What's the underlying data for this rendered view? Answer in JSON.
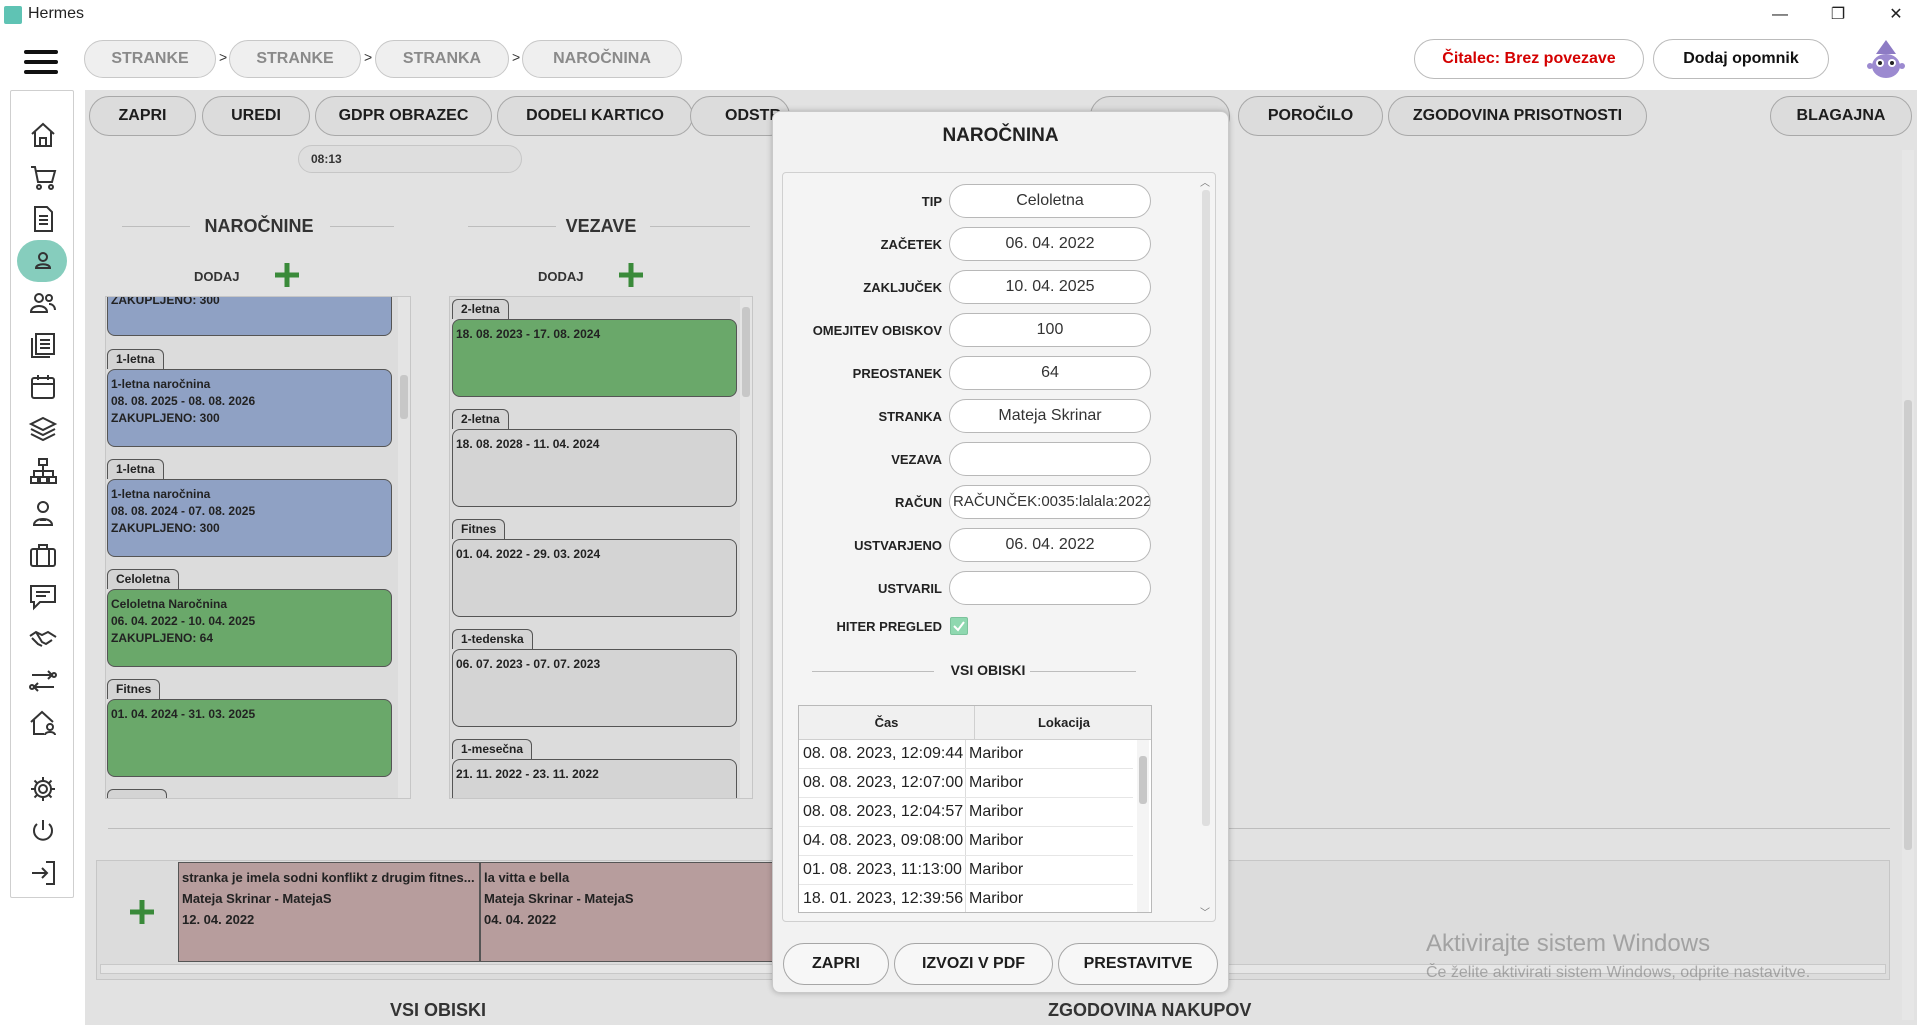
{
  "window": {
    "title": "Hermes",
    "minimize": "—",
    "restore": "❐",
    "close": "✕"
  },
  "breadcrumbs": [
    "STRANKE",
    "STRANKE",
    "STRANKA",
    "NAROČNINA"
  ],
  "breadcrumb_separator": ">",
  "header": {
    "reader_status": "Čitalec: Brez povezave",
    "add_reminder": "Dodaj opomnik"
  },
  "sidebar": {
    "items": [
      {
        "icon": "home-icon"
      },
      {
        "icon": "cart-icon"
      },
      {
        "icon": "document-icon"
      },
      {
        "icon": "user-icon",
        "active": true
      },
      {
        "icon": "users-icon"
      },
      {
        "icon": "list-icon"
      },
      {
        "icon": "calendar-icon"
      },
      {
        "icon": "layers-icon"
      },
      {
        "icon": "hierarchy-icon"
      },
      {
        "icon": "trainer-icon"
      },
      {
        "icon": "briefcase-icon"
      },
      {
        "icon": "message-icon"
      },
      {
        "icon": "handshake-icon"
      },
      {
        "icon": "transfer-icon"
      },
      {
        "icon": "house-icon"
      },
      {
        "icon": "settings-icon"
      },
      {
        "icon": "power-icon"
      },
      {
        "icon": "logout-icon"
      }
    ]
  },
  "toolbar": {
    "zapri": "ZAPRI",
    "uredi": "UREDI",
    "gdpr": "GDPR OBRAZEC",
    "dodeli": "DODELI KARTICO",
    "odstr": "ODSTR",
    "porocilo": "POROČILO",
    "zgodovina": "ZGODOVINA PRISOTNOSTI",
    "blagajna": "BLAGAJNA"
  },
  "time": "08:13",
  "narocnine": {
    "title": "NAROČNINE",
    "add_label": "DODAJ",
    "cards": [
      {
        "tag": "",
        "lines": [
          "ZAKUPLJENO: 300"
        ],
        "color": "blue"
      },
      {
        "tag": "1-letna",
        "lines": [
          "1-letna naročnina",
          "08. 08. 2025 - 08. 08. 2026",
          "ZAKUPLJENO: 300"
        ],
        "color": "blue"
      },
      {
        "tag": "1-letna",
        "lines": [
          "1-letna naročnina",
          "08. 08. 2024 - 07. 08. 2025",
          "ZAKUPLJENO: 300"
        ],
        "color": "blue"
      },
      {
        "tag": "Celoletna",
        "lines": [
          "Celoletna Naročnina",
          "06. 04. 2022 - 10. 04. 2025",
          "ZAKUPLJENO: 64"
        ],
        "color": "green"
      },
      {
        "tag": "Fitnes",
        "lines": [
          "01. 04. 2024 - 31. 03. 2025"
        ],
        "color": "green"
      }
    ]
  },
  "vezave": {
    "title": "VEZAVE",
    "add_label": "DODAJ",
    "cards": [
      {
        "tag": "2-letna",
        "lines": [
          "18. 08. 2023 - 17. 08. 2024"
        ],
        "color": "green"
      },
      {
        "tag": "2-letna",
        "lines": [
          "18. 08. 2028 - 11. 04. 2024"
        ],
        "color": "gray"
      },
      {
        "tag": "Fitnes",
        "lines": [
          "01. 04. 2022 - 29. 03. 2024"
        ],
        "color": "gray"
      },
      {
        "tag": "1-tedenska",
        "lines": [
          "06. 07. 2023 - 07. 07. 2023"
        ],
        "color": "gray"
      },
      {
        "tag": "1-mesečna",
        "lines": [
          "21. 11. 2022 - 23. 11. 2022"
        ],
        "color": "gray"
      }
    ]
  },
  "notes": [
    {
      "text": "stranka je imela sodni konflikt z drugim fitnes...",
      "author": "Mateja Skrinar - MatejaS",
      "date": "12. 04. 2022"
    },
    {
      "text": "la vitta e bella",
      "author": "Mateja Skrinar - MatejaS",
      "date": "04. 04. 2022"
    }
  ],
  "bottom": {
    "vsi_obiski": "VSI OBISKI",
    "zgodovina_nakupov": "ZGODOVINA NAKUPOV"
  },
  "watermark": {
    "line1": "Aktivirajte sistem Windows",
    "line2": "Če želite aktivirati sistem Windows, odprite nastavitve."
  },
  "modal": {
    "title": "NAROČNINA",
    "fields": [
      {
        "label": "TIP",
        "value": "Celoletna"
      },
      {
        "label": "ZAČETEK",
        "value": "06. 04. 2022"
      },
      {
        "label": "ZAKLJUČEK",
        "value": "10. 04. 2025"
      },
      {
        "label": "OMEJITEV OBISKOV",
        "value": "100"
      },
      {
        "label": "PREOSTANEK",
        "value": "64"
      },
      {
        "label": "STRANKA",
        "value": "Mateja Skrinar"
      },
      {
        "label": "VEZAVA",
        "value": ""
      },
      {
        "label": "RAČUN",
        "value": "RAČUNČEK:0035:lalala:2022"
      },
      {
        "label": "USTVARJENO",
        "value": "06. 04. 2022"
      },
      {
        "label": "USTVARIL",
        "value": ""
      }
    ],
    "quick_view_label": "HITER PREGLED",
    "quick_view_checked": true,
    "visits_title": "VSI OBISKI",
    "visits_columns": [
      "Čas",
      "Lokacija"
    ],
    "visits": [
      {
        "time": "08. 08. 2023, 12:09:44",
        "location": "Maribor"
      },
      {
        "time": "08. 08. 2023, 12:07:00",
        "location": "Maribor"
      },
      {
        "time": "08. 08. 2023, 12:04:57",
        "location": "Maribor"
      },
      {
        "time": "04. 08. 2023, 09:08:00",
        "location": "Maribor"
      },
      {
        "time": "01. 08. 2023, 11:13:00",
        "location": "Maribor"
      },
      {
        "time": "18. 01. 2023, 12:39:56",
        "location": "Maribor"
      }
    ],
    "buttons": {
      "zapri": "ZAPRI",
      "pdf": "IZVOZI V PDF",
      "prestavitve": "PRESTAVITVE"
    }
  },
  "colors": {
    "accent": "#86cdbd",
    "reader_status": "#d40000",
    "card_blue": "#8fa1c4",
    "card_green": "#6aa86a",
    "note": "#b79d9d",
    "plus": "#3a8a3a"
  }
}
